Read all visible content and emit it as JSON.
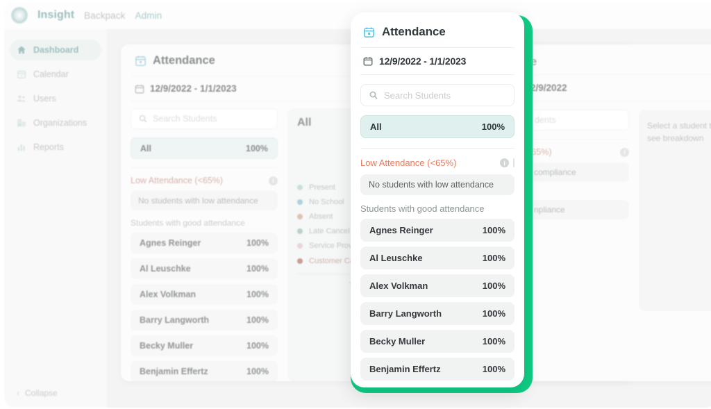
{
  "topnav": {
    "logo_name": "insight-logo",
    "brand": "Insight",
    "links": [
      {
        "label": "Backpack",
        "accent": false
      },
      {
        "label": "Admin",
        "accent": true
      }
    ]
  },
  "sidebar": {
    "items": [
      {
        "label": "Dashboard",
        "icon": "home-icon",
        "active": true
      },
      {
        "label": "Calendar",
        "icon": "calendar-icon",
        "active": false
      },
      {
        "label": "Users",
        "icon": "users-icon",
        "active": false
      },
      {
        "label": "Organizations",
        "icon": "building-icon",
        "active": false
      },
      {
        "label": "Reports",
        "icon": "bar-chart-icon",
        "active": false
      }
    ],
    "collapse_label": "Collapse",
    "collapse_icon": "chevron-left-icon"
  },
  "background_panel": {
    "title": "Attendance",
    "title_icon": "calendar-icon",
    "date_range": "12/9/2022 - 1/1/2023",
    "date_icon": "calendar-outline-icon",
    "search_placeholder": "Search Students",
    "search_icon": "search-icon",
    "all_row": {
      "label": "All",
      "value": "100%"
    },
    "low_attendance": {
      "heading": "Low Attendance (<65%)",
      "info_icon": "info-icon",
      "empty_text": "No students with low attendance"
    },
    "good_attendance_label": "Students with good attendance",
    "students": [
      {
        "name": "Agnes Reinger",
        "value": "100%"
      },
      {
        "name": "Al Leuschke",
        "value": "100%"
      },
      {
        "name": "Alex Volkman",
        "value": "100%"
      },
      {
        "name": "Barry Langworth",
        "value": "100%"
      },
      {
        "name": "Becky Muller",
        "value": "100%"
      },
      {
        "name": "Benjamin Effertz",
        "value": "100%"
      }
    ],
    "chart": {
      "title": "All",
      "total_label": "Total"
    }
  },
  "background_panel_2": {
    "title_fragment": "e",
    "date_fragment": "2/9/2022",
    "search_fragment": "dents",
    "low_fragment": "<65%)",
    "info_icon": "info-icon",
    "pill_1_fragment": "compliance",
    "pill_2_fragment": "npliance",
    "empty_state": "Select a student to see breakdown"
  },
  "modal": {
    "title": "Attendance",
    "title_icon": "calendar-icon",
    "date_range": "12/9/2022 - 1/1/2023",
    "date_icon": "calendar-outline-icon",
    "search_placeholder": "Search Students",
    "search_icon": "search-icon",
    "all_row": {
      "label": "All",
      "value": "100%"
    },
    "low_attendance": {
      "heading": "Low Attendance (<65%)",
      "info_icon": "info-icon",
      "empty_text": "No students with low attendance"
    },
    "good_attendance_label": "Students with good attendance",
    "students": [
      {
        "name": "Agnes Reinger",
        "value": "100%"
      },
      {
        "name": "Al Leuschke",
        "value": "100%"
      },
      {
        "name": "Alex Volkman",
        "value": "100%"
      },
      {
        "name": "Barry Langworth",
        "value": "100%"
      },
      {
        "name": "Becky Muller",
        "value": "100%"
      },
      {
        "name": "Benjamin Effertz",
        "value": "100%"
      }
    ],
    "focus_ring_color": "#10cd85"
  },
  "chart_data": {
    "type": "pie",
    "title": "All",
    "categories": [
      "Present",
      "No School",
      "Absent",
      "Late Cancel",
      "Service Provider Cancelled",
      "Customer Cancelled"
    ],
    "colors": [
      "#8fd4cd",
      "#56bde0",
      "#f0947a",
      "#7fb7ae",
      "#e9b9b4",
      "#d4553c"
    ],
    "total_label": "Total",
    "legend_position": "left"
  },
  "colors": {
    "accent_teal": "#46a099",
    "accent_green": "#10cd85",
    "warn_orange": "#e8795c",
    "calendar_blue": "#5bc6e8"
  }
}
